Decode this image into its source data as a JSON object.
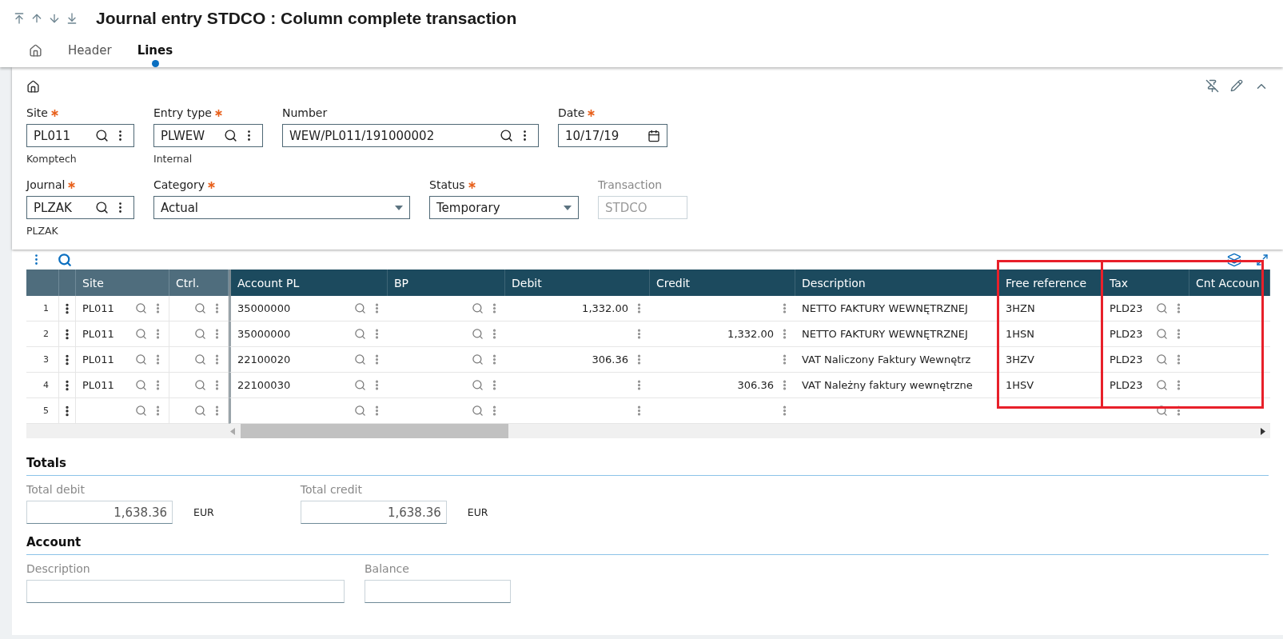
{
  "title": "Journal entry STDCO : Column complete transaction",
  "tabs": [
    {
      "kind": "home",
      "selected": false
    },
    {
      "kind": "text",
      "label": "Header",
      "selected": false
    },
    {
      "kind": "text",
      "label": "Lines",
      "selected": true
    }
  ],
  "form": [
    [
      {
        "label": "Site",
        "required": true,
        "kind": "lookup",
        "disabled": false,
        "value": "PL011",
        "note": "Komptech"
      },
      {
        "label": "Entry type",
        "required": true,
        "kind": "lookup",
        "disabled": false,
        "value": "PLWEW",
        "note": "Internal"
      },
      {
        "label": "Number",
        "required": false,
        "kind": "lookup",
        "disabled": false,
        "value": "WEW/PL011/191000002"
      },
      {
        "label": "Date",
        "required": true,
        "kind": "date",
        "disabled": false,
        "value": "10/17/19"
      }
    ],
    [
      {
        "label": "Journal",
        "required": true,
        "kind": "lookup",
        "disabled": false,
        "value": "PLZAK",
        "note": "PLZAK"
      },
      {
        "label": "Category",
        "required": true,
        "kind": "select",
        "disabled": false,
        "value": "Actual"
      },
      {
        "label": "Status",
        "required": true,
        "kind": "select",
        "disabled": false,
        "value": "Temporary"
      },
      {
        "label": "Transaction",
        "required": false,
        "kind": "text",
        "disabled": true,
        "value": "STDCO"
      }
    ]
  ],
  "grid": {
    "columns": [
      {
        "label": "Site",
        "frozen": true,
        "kind": "text",
        "highlighted": false
      },
      {
        "label": "Ctrl.",
        "frozen": true,
        "kind": "text",
        "highlighted": false
      },
      {
        "label": "Account PL",
        "frozen": false,
        "kind": "text",
        "highlighted": false
      },
      {
        "label": "BP",
        "frozen": false,
        "kind": "text",
        "highlighted": false
      },
      {
        "label": "Debit",
        "frozen": false,
        "kind": "amount",
        "highlighted": false
      },
      {
        "label": "Credit",
        "frozen": false,
        "kind": "amount",
        "highlighted": false
      },
      {
        "label": "Description",
        "frozen": false,
        "kind": "text",
        "highlighted": false
      },
      {
        "label": "Free reference",
        "frozen": false,
        "kind": "text",
        "highlighted": true
      },
      {
        "label": "Tax",
        "frozen": false,
        "kind": "text",
        "highlighted": true
      },
      {
        "label": "Cnt Accoun",
        "frozen": false,
        "kind": "text",
        "highlighted": false
      }
    ],
    "rows": [
      {
        "number": "1",
        "cells": [
          {
            "text": "PL011",
            "lookup": true,
            "menu": true
          },
          {
            "lookup": true,
            "menu": true
          },
          {
            "text": "35000000",
            "lookup": true,
            "menu": true
          },
          {
            "lookup": true,
            "menu": true
          },
          {
            "text": "1,332.00",
            "lookup": false,
            "menu": true
          },
          {
            "lookup": false,
            "menu": true
          },
          {
            "text": "NETTO FAKTURY WEWNĘTRZNEJ",
            "lookup": false,
            "menu": false
          },
          {
            "text": "3HZN",
            "lookup": false,
            "menu": false
          },
          {
            "text": "PLD23",
            "lookup": true,
            "menu": true
          },
          {
            "lookup": false,
            "menu": false
          }
        ]
      },
      {
        "number": "2",
        "cells": [
          {
            "text": "PL011",
            "lookup": true,
            "menu": true
          },
          {
            "lookup": true,
            "menu": true
          },
          {
            "text": "35000000",
            "lookup": true,
            "menu": true
          },
          {
            "lookup": true,
            "menu": true
          },
          {
            "lookup": false,
            "menu": true
          },
          {
            "text": "1,332.00",
            "lookup": false,
            "menu": true
          },
          {
            "text": "NETTO FAKTURY WEWNĘTRZNEJ",
            "lookup": false,
            "menu": false
          },
          {
            "text": "1HSN",
            "lookup": false,
            "menu": false
          },
          {
            "text": "PLD23",
            "lookup": true,
            "menu": true
          },
          {
            "lookup": false,
            "menu": false
          }
        ]
      },
      {
        "number": "3",
        "cells": [
          {
            "text": "PL011",
            "lookup": true,
            "menu": true
          },
          {
            "lookup": true,
            "menu": true
          },
          {
            "text": "22100020",
            "lookup": true,
            "menu": true
          },
          {
            "lookup": true,
            "menu": true
          },
          {
            "text": "306.36",
            "lookup": false,
            "menu": true
          },
          {
            "lookup": false,
            "menu": true
          },
          {
            "text": "VAT Naliczony Faktury Wewnętrz",
            "lookup": false,
            "menu": false
          },
          {
            "text": "3HZV",
            "lookup": false,
            "menu": false
          },
          {
            "text": "PLD23",
            "lookup": true,
            "menu": true
          },
          {
            "lookup": false,
            "menu": false
          }
        ]
      },
      {
        "number": "4",
        "cells": [
          {
            "text": "PL011",
            "lookup": true,
            "menu": true
          },
          {
            "lookup": true,
            "menu": true
          },
          {
            "text": "22100030",
            "lookup": true,
            "menu": true
          },
          {
            "lookup": true,
            "menu": true
          },
          {
            "lookup": false,
            "menu": true
          },
          {
            "text": "306.36",
            "lookup": false,
            "menu": true
          },
          {
            "text": "VAT Należny faktury wewnętrzne",
            "lookup": false,
            "menu": false
          },
          {
            "text": "1HSV",
            "lookup": false,
            "menu": false
          },
          {
            "text": "PLD23",
            "lookup": true,
            "menu": true
          },
          {
            "lookup": false,
            "menu": false
          }
        ]
      },
      {
        "number": "5",
        "cells": [
          {
            "lookup": true,
            "menu": true
          },
          {
            "lookup": true,
            "menu": true
          },
          {
            "lookup": true,
            "menu": true
          },
          {
            "lookup": true,
            "menu": true
          },
          {
            "lookup": false,
            "menu": true
          },
          {
            "lookup": false,
            "menu": true
          },
          {
            "lookup": false,
            "menu": false
          },
          {
            "lookup": false,
            "menu": false
          },
          {
            "lookup": true,
            "menu": true
          },
          {
            "lookup": false,
            "menu": false
          }
        ]
      }
    ]
  },
  "totals": {
    "title": "Totals",
    "fields": [
      {
        "label": "Total debit",
        "value": "1,638.36",
        "currency": "EUR"
      },
      {
        "label": "Total credit",
        "value": "1,638.36",
        "currency": "EUR"
      }
    ]
  },
  "account": {
    "title": "Account",
    "fields": [
      {
        "label": "Description"
      },
      {
        "label": "Balance"
      }
    ]
  }
}
